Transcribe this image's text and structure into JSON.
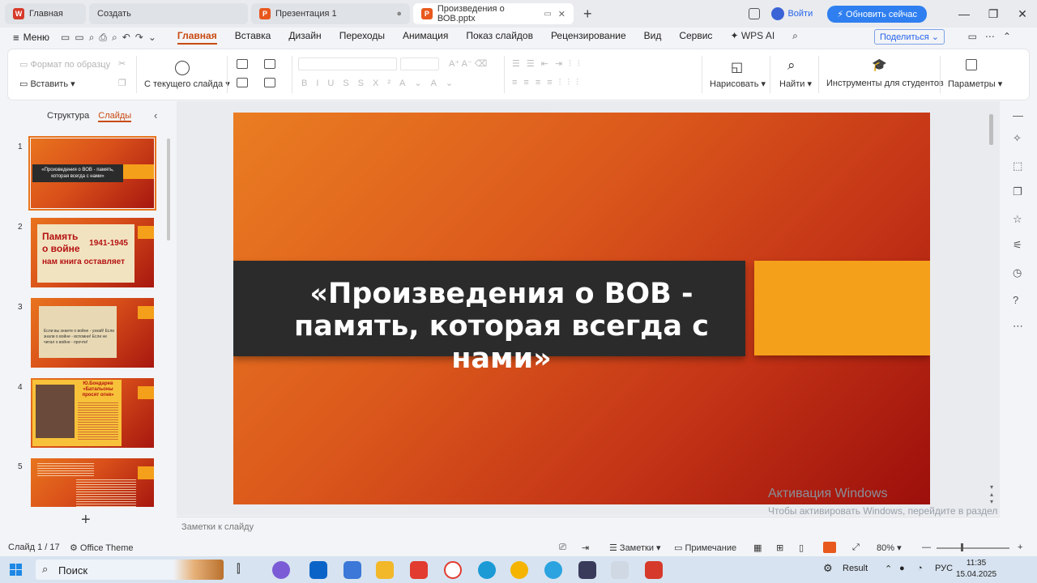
{
  "tabs": {
    "home": "Главная",
    "create": "Создать",
    "pres1": "Презентация 1",
    "active": "Произведения о ВОВ.pptx"
  },
  "titlebar": {
    "login": "Войти",
    "upgrade": "Обновить сейчас"
  },
  "menubar": {
    "menu": "Меню",
    "tabs": [
      "Главная",
      "Вставка",
      "Дизайн",
      "Переходы",
      "Анимация",
      "Показ слайдов",
      "Рецензирование",
      "Вид",
      "Сервис"
    ],
    "wps_ai": "WPS AI",
    "share": "Поделиться"
  },
  "ribbon": {
    "format_painter": "Формат по образцу",
    "paste": "Вставить",
    "from_current": "С текущего слайда",
    "draw": "Нарисовать",
    "find": "Найти",
    "student_tools": "Инструменты для студентов",
    "settings": "Параметры"
  },
  "leftpanel": {
    "structure": "Структура",
    "slides": "Слайды",
    "thumbs": [
      {
        "num": "1",
        "text": "«Произведения о ВОВ - память, которая всегда с нами»"
      },
      {
        "num": "2",
        "text1": "Память",
        "text2": "о войне",
        "text3": "нам книга оставляет",
        "date": "1941-1945"
      },
      {
        "num": "3",
        "text": "Если вы знаете о войне - узнай! Если знали о войне - вспомни! Если не читал о войне - прочти!"
      },
      {
        "num": "4",
        "text": "Ю.Бондарев «Батальоны просят огня»"
      },
      {
        "num": "5"
      }
    ]
  },
  "slide": {
    "title": "«Произведения о ВОВ - память, которая всегда с нами»"
  },
  "watermark": {
    "line1": "Активация Windows",
    "line2": "Чтобы активировать Windows, перейдите в раздел \"Параметры\"."
  },
  "notes": {
    "placeholder": "Заметки к слайду"
  },
  "status": {
    "slide": "Слайд 1 / 17",
    "theme": "Office Theme",
    "notes": "Заметки",
    "comment": "Примечание",
    "zoom": "80%",
    "zoom_fraction": 0.5
  },
  "taskbar": {
    "search": "Поиск",
    "result": "Result",
    "lang": "РУС",
    "time": "11:35",
    "date": "15.04.2025"
  }
}
